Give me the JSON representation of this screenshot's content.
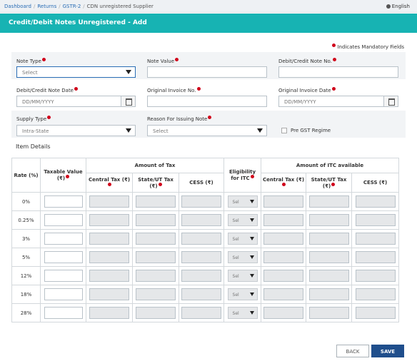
{
  "breadcrumb": {
    "items": [
      "Dashboard",
      "Returns",
      "GSTR-2"
    ],
    "current": "CDN unregistered Supplier",
    "separator": "/"
  },
  "language": "English",
  "page": {
    "title": "Credit/Debit Notes Unregistered - Add"
  },
  "mandatory_note": "Indicates Mandatory Fields",
  "form": {
    "note_type": {
      "label": "Note Type",
      "value": "Select"
    },
    "note_value": {
      "label": "Note Value",
      "value": ""
    },
    "note_no": {
      "label": "Debit/Credit Note No.",
      "value": ""
    },
    "note_date": {
      "label": "Debit/Credit Note Date",
      "placeholder": "DD/MM/YYYY"
    },
    "orig_invoice_no": {
      "label": "Original Invoice No.",
      "value": ""
    },
    "orig_invoice_date": {
      "label": "Original Invoice Date",
      "placeholder": "DD/MM/YYYY"
    },
    "supply_type": {
      "label": "Supply Type",
      "value": "Intra-State"
    },
    "reason": {
      "label": "Reason For Issuing Note",
      "value": "Select"
    },
    "pre_gst": {
      "label": "Pre GST Regime",
      "checked": false
    }
  },
  "item_details": {
    "title": "Item Details",
    "headers": {
      "rate": "Rate (%)",
      "taxable": "Taxable Value (₹)",
      "amount_of_tax": "Amount of Tax",
      "central_tax": "Central Tax (₹)",
      "state_tax": "State/UT Tax (₹)",
      "cess": "CESS (₹)",
      "eligibility": "Eligibility for ITC",
      "itc_available": "Amount of ITC available",
      "itc_central": "Central Tax (₹)",
      "itc_state": "State/UT Tax (₹)",
      "itc_cess": "CESS (₹)"
    },
    "rows": [
      {
        "rate": "0%",
        "eligibility": "Sel"
      },
      {
        "rate": "0.25%",
        "eligibility": "Sel"
      },
      {
        "rate": "3%",
        "eligibility": "Sel"
      },
      {
        "rate": "5%",
        "eligibility": "Sel"
      },
      {
        "rate": "12%",
        "eligibility": "Sel"
      },
      {
        "rate": "18%",
        "eligibility": "Sel"
      },
      {
        "rate": "28%",
        "eligibility": "Sel"
      }
    ]
  },
  "buttons": {
    "back": "BACK",
    "save": "SAVE"
  },
  "colors": {
    "header": "#17b3b3",
    "save_button": "#1f4e8c",
    "required_dot": "#d0021b",
    "link": "#2a6db5"
  },
  "icons": {
    "calendar": "calendar-icon",
    "dropdown": "chevron-down-icon",
    "language": "globe-icon"
  }
}
